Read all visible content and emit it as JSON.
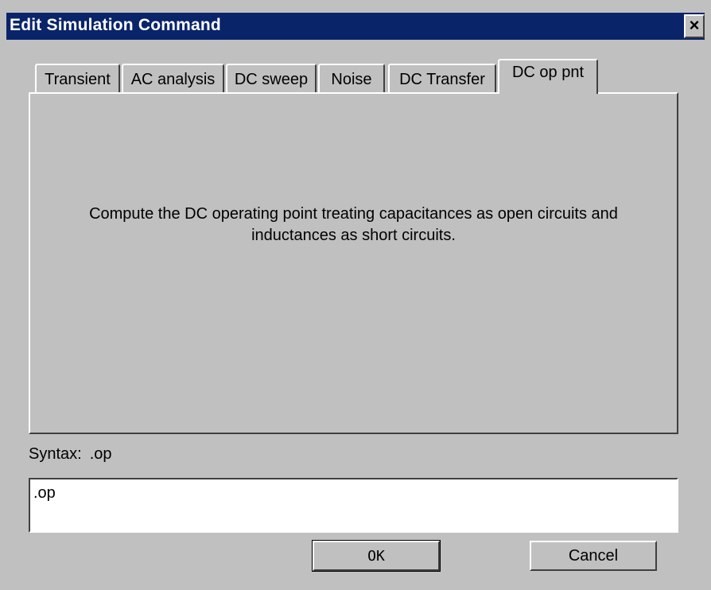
{
  "dialog": {
    "title": "Edit Simulation Command",
    "close_glyph": "×"
  },
  "tabs": [
    {
      "label": "Transient",
      "active": false
    },
    {
      "label": "AC analysis",
      "active": false
    },
    {
      "label": "DC sweep",
      "active": false
    },
    {
      "label": "Noise",
      "active": false
    },
    {
      "label": "DC Transfer",
      "active": false
    },
    {
      "label": "DC op pnt",
      "active": true
    }
  ],
  "panel": {
    "description": "Compute the DC operating point treating capacitances as open circuits and inductances as short circuits."
  },
  "syntax": {
    "label": "Syntax:",
    "value": ".op"
  },
  "command": {
    "value": ".op"
  },
  "buttons": {
    "ok_label": "OK",
    "cancel_label": "Cancel"
  },
  "colors": {
    "face": "#c0c0c0",
    "titlebar": "#0a246a",
    "title_text": "#ffffff"
  },
  "icons": {
    "close": "close-icon"
  }
}
